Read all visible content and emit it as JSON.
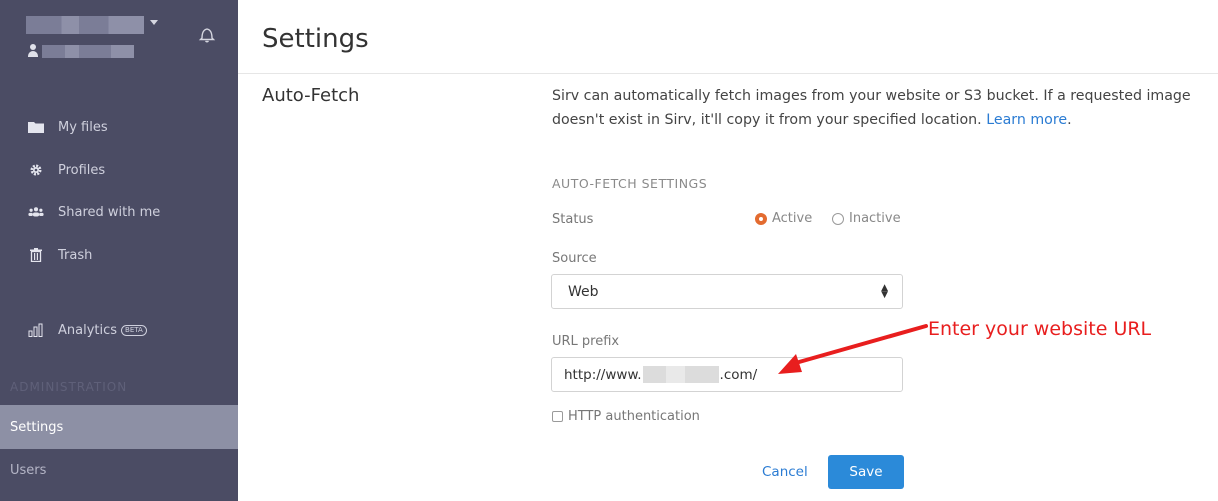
{
  "sidebar": {
    "items": [
      {
        "label": "My files",
        "icon": "folder-icon"
      },
      {
        "label": "Profiles",
        "icon": "gear-icon"
      },
      {
        "label": "Shared with me",
        "icon": "users-icon"
      },
      {
        "label": "Trash",
        "icon": "trash-icon"
      },
      {
        "label": "Analytics",
        "icon": "bar-chart-icon",
        "badge": "BETA"
      }
    ],
    "admin_label": "ADMINISTRATION",
    "settings_label": "Settings",
    "users_label": "Users"
  },
  "page": {
    "title": "Settings"
  },
  "section": {
    "title": "Auto-Fetch",
    "description": "Sirv can automatically fetch images from your website or S3 bucket. If a requested image doesn't exist in Sirv, it'll copy it from your specified location.",
    "learn_more": "Learn more",
    "learn_more_suffix": "."
  },
  "form": {
    "heading": "AUTO-FETCH SETTINGS",
    "status_label": "Status",
    "status_active": "Active",
    "status_inactive": "Inactive",
    "status_selected": "Active",
    "source_label": "Source",
    "source_value": "Web",
    "url_label": "URL prefix",
    "url_prefix": "http://www.",
    "url_suffix": ".com/",
    "http_auth_label": "HTTP authentication",
    "cancel": "Cancel",
    "save": "Save"
  },
  "annotation": {
    "text": "Enter your website URL",
    "color": "#e81e1e"
  },
  "colors": {
    "sidebar_bg": "#4b4c64",
    "sidebar_active": "#8d90a5",
    "accent_blue": "#2b8ad9",
    "radio_active": "#e36b30"
  }
}
